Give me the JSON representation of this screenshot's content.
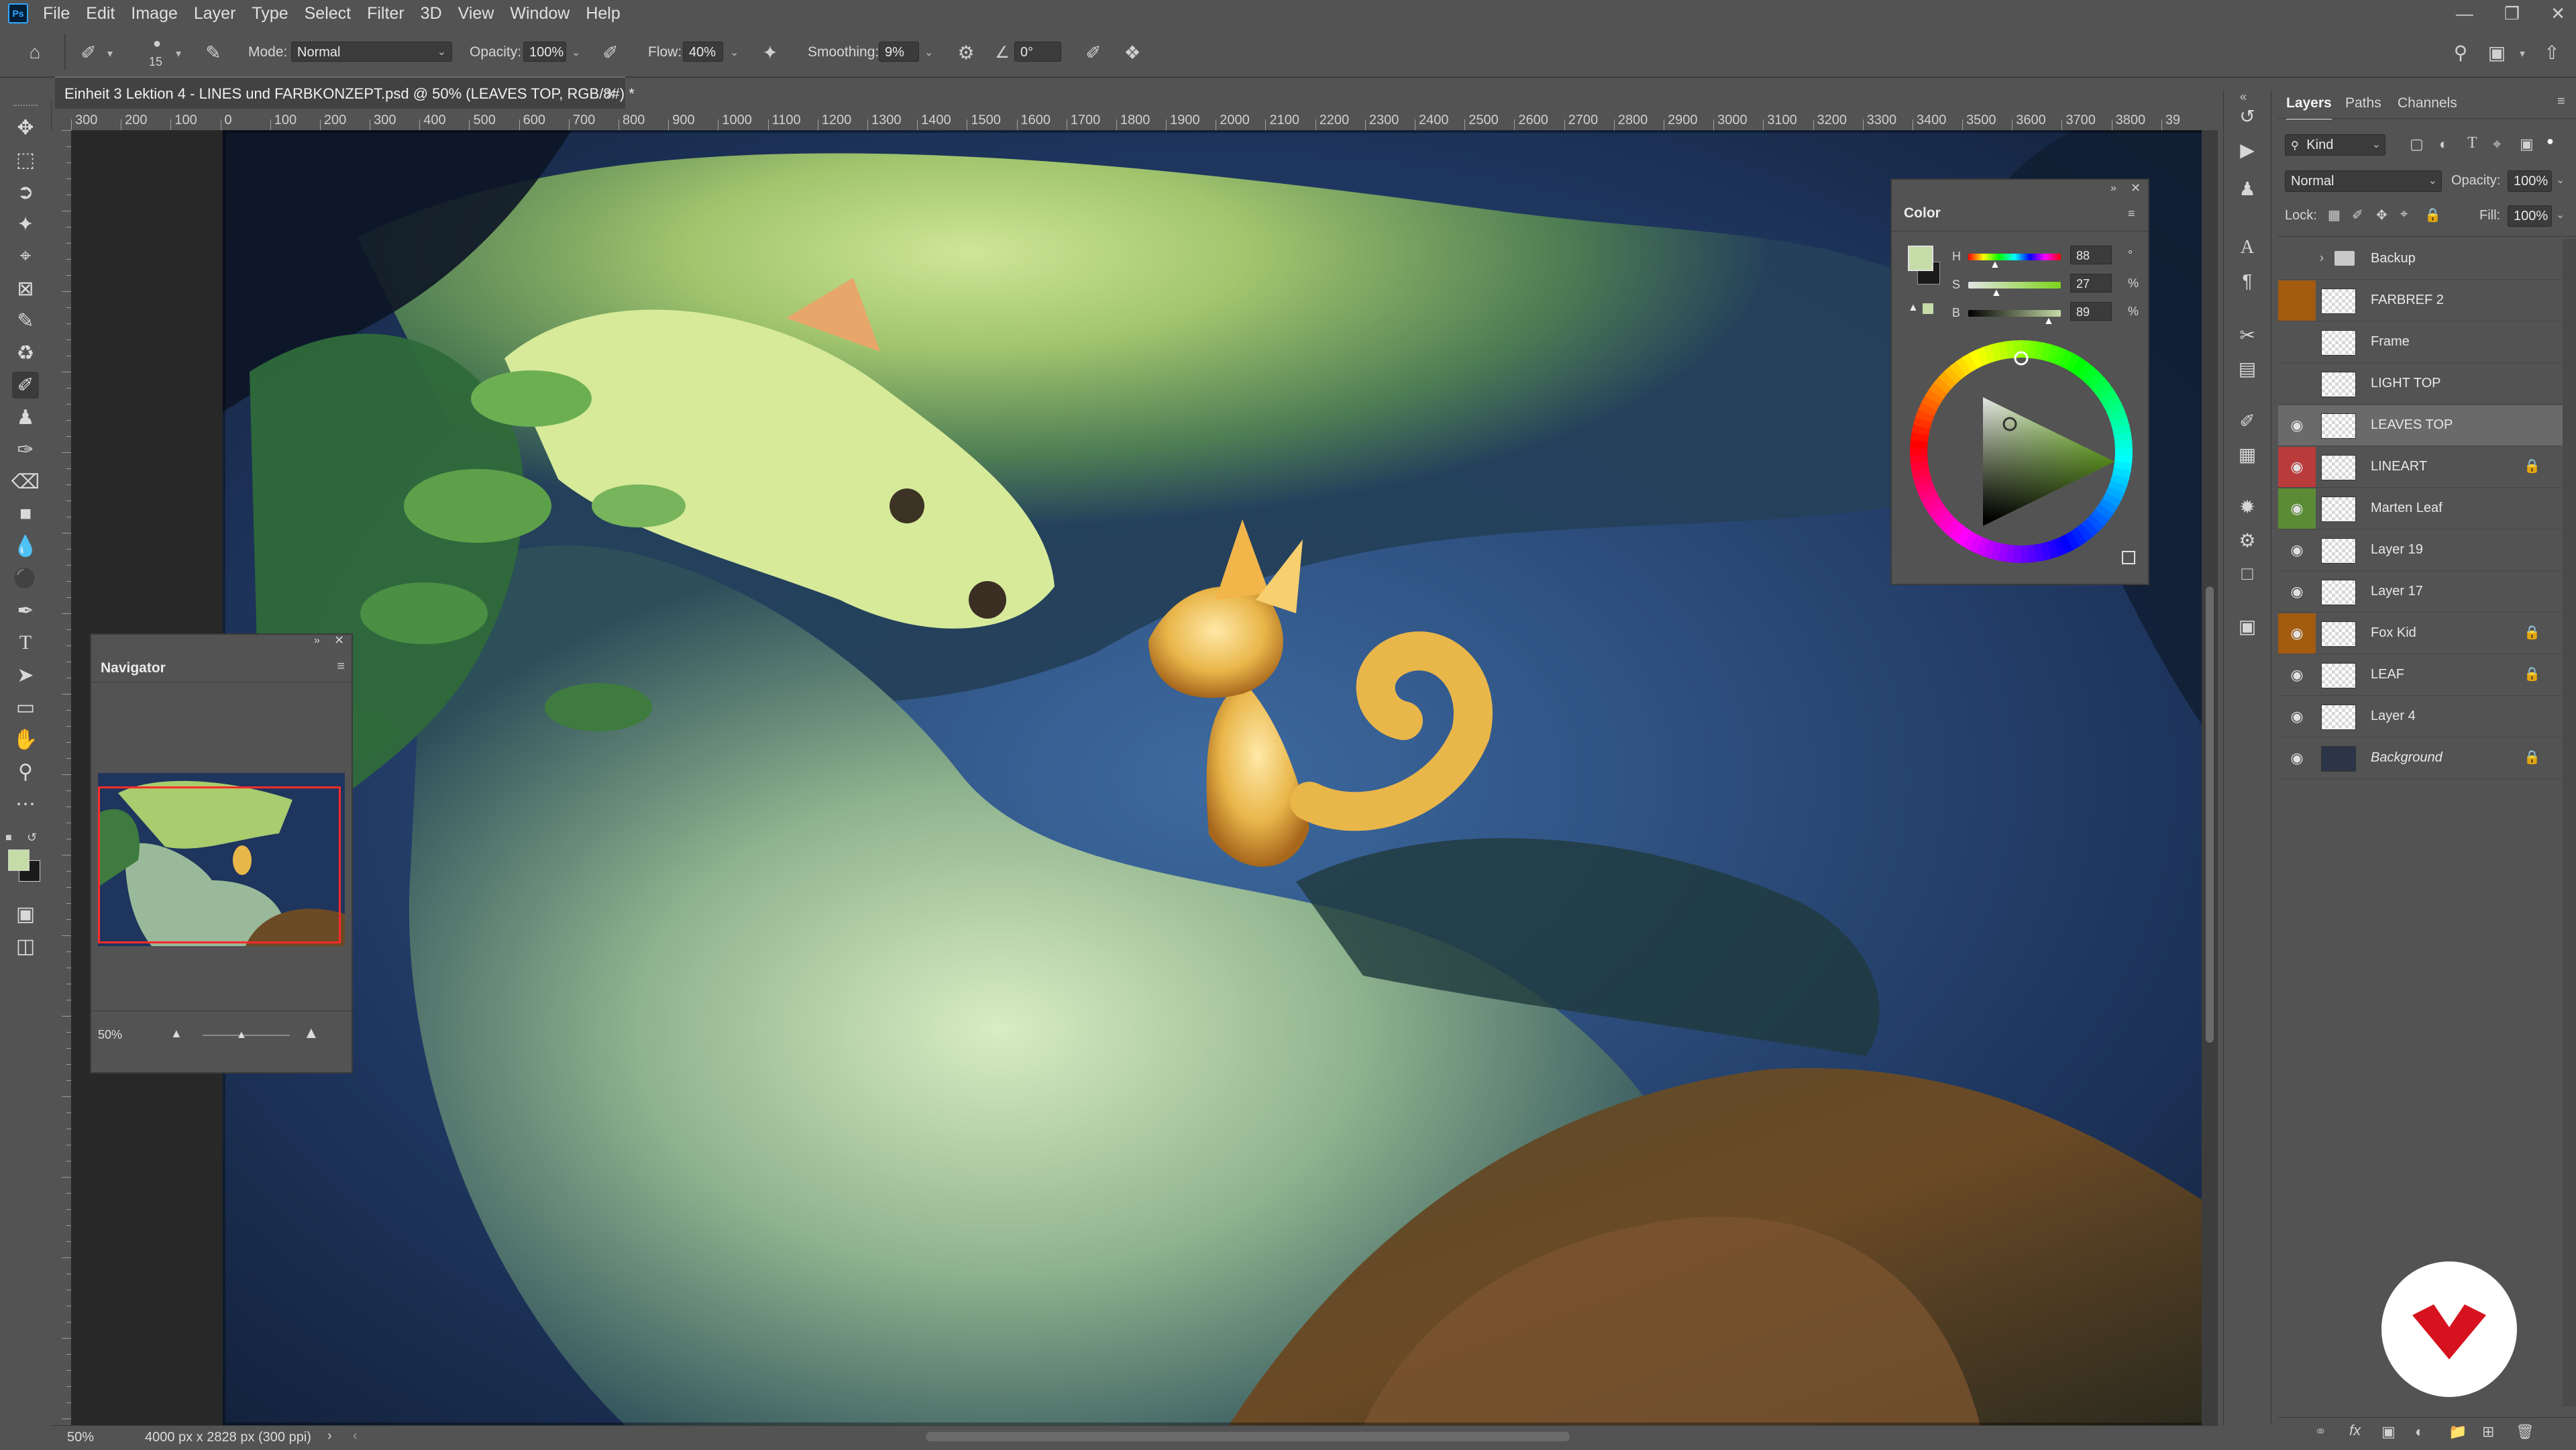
{
  "menubar": {
    "logo": "Ps",
    "items": [
      "File",
      "Edit",
      "Image",
      "Layer",
      "Type",
      "Select",
      "Filter",
      "3D",
      "View",
      "Window",
      "Help"
    ],
    "window_controls": [
      "minimize-icon",
      "restore-icon",
      "close-icon"
    ]
  },
  "options": {
    "brush_size": "15",
    "mode_label": "Mode:",
    "mode_value": "Normal",
    "opacity_label": "Opacity:",
    "opacity_value": "100%",
    "flow_label": "Flow:",
    "flow_value": "40%",
    "smoothing_label": "Smoothing:",
    "smoothing_value": "9%",
    "angle_value": "0°"
  },
  "document": {
    "tab_title": "Einheit 3 Lektion 4 - LINES und FARBKONZEPT.psd @ 50% (LEAVES TOP, RGB/8#) *",
    "zoom": "50%",
    "doc_size": "4000 px x 2828 px (300 ppi)"
  },
  "ruler": {
    "h_labels": [
      "300",
      "200",
      "100",
      "0",
      "100",
      "200",
      "300",
      "400",
      "500",
      "600",
      "700",
      "800",
      "900",
      "1000",
      "1100",
      "1200",
      "1300",
      "1400",
      "1500",
      "1600",
      "1700",
      "1800",
      "1900",
      "2000",
      "2100",
      "2200",
      "2300",
      "2400",
      "2500",
      "2600",
      "2700",
      "2800",
      "2900",
      "3000",
      "3100",
      "3200",
      "3300",
      "3400",
      "3500",
      "3600",
      "3700",
      "3800",
      "39"
    ]
  },
  "navigator": {
    "title": "Navigator",
    "zoom": "50%"
  },
  "color_panel": {
    "title": "Color",
    "h_label": "H",
    "h_value": "88",
    "h_unit": "°",
    "s_label": "S",
    "s_value": "27",
    "s_unit": "%",
    "b_label": "B",
    "b_value": "89",
    "b_unit": "%",
    "foreground": "#c6dca8",
    "background": "#1a1a1a"
  },
  "layers_panel": {
    "tabs": [
      "Layers",
      "Paths",
      "Channels"
    ],
    "filter_kind": "Kind",
    "blend_mode": "Normal",
    "opacity_label": "Opacity:",
    "opacity_value": "100%",
    "lock_label": "Lock:",
    "fill_label": "Fill:",
    "fill_value": "100%",
    "layers": [
      {
        "name": "Backup",
        "visible": false,
        "type": "group",
        "color": "",
        "locked": false
      },
      {
        "name": "FARBREF 2",
        "visible": false,
        "type": "layer",
        "color": "#a35b10",
        "locked": false
      },
      {
        "name": "Frame",
        "visible": false,
        "type": "layer",
        "color": "",
        "locked": false
      },
      {
        "name": "LIGHT TOP",
        "visible": false,
        "type": "layer",
        "color": "",
        "locked": false
      },
      {
        "name": "LEAVES TOP",
        "visible": true,
        "type": "layer",
        "color": "",
        "locked": false,
        "selected": true
      },
      {
        "name": "LINEART",
        "visible": true,
        "type": "layer",
        "color": "#b93b3b",
        "locked": true
      },
      {
        "name": "Marten Leaf",
        "visible": true,
        "type": "layer",
        "color": "#5b8c35",
        "locked": false
      },
      {
        "name": "Layer 19",
        "visible": true,
        "type": "layer",
        "color": "",
        "locked": false
      },
      {
        "name": "Layer 17",
        "visible": true,
        "type": "layer",
        "color": "",
        "locked": false
      },
      {
        "name": "Fox Kid",
        "visible": true,
        "type": "layer",
        "color": "#a35b10",
        "locked": true
      },
      {
        "name": "LEAF",
        "visible": true,
        "type": "layer",
        "color": "",
        "locked": true
      },
      {
        "name": "Layer 4",
        "visible": true,
        "type": "layer",
        "color": "",
        "locked": false
      },
      {
        "name": "Background",
        "visible": true,
        "type": "layer",
        "color": "",
        "locked": true
      }
    ]
  }
}
